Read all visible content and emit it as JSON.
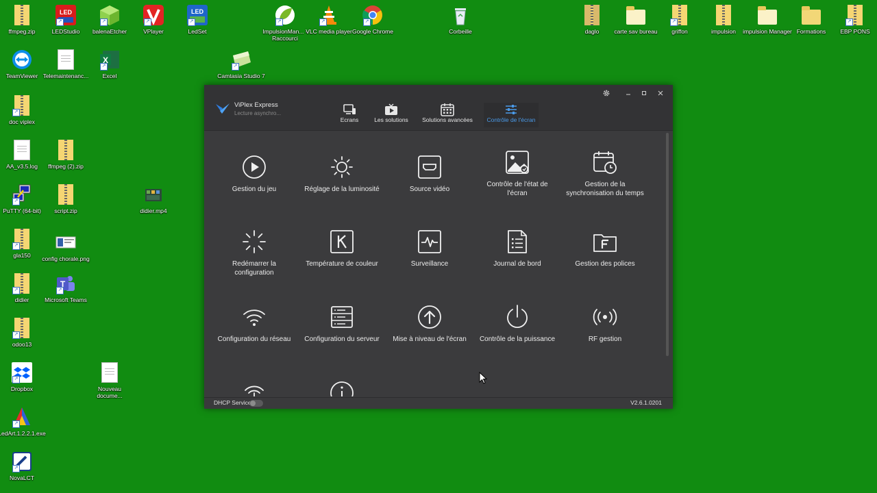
{
  "desktop": {
    "icons": [
      {
        "label": "ffmpeg.zip"
      },
      {
        "label": "LEDStudio"
      },
      {
        "label": "balenaEtcher"
      },
      {
        "label": "VPlayer"
      },
      {
        "label": "LedSet"
      },
      {
        "label": "ImpulsionMan... - Raccourci"
      },
      {
        "label": "VLC media player"
      },
      {
        "label": "Google Chrome"
      },
      {
        "label": "Corbeille"
      },
      {
        "label": "daglo"
      },
      {
        "label": "carte sav bureau"
      },
      {
        "label": "griffon"
      },
      {
        "label": "impulsion"
      },
      {
        "label": "impulsion Manager"
      },
      {
        "label": "Formations"
      },
      {
        "label": "EBP PONS"
      },
      {
        "label": "TeamViewer"
      },
      {
        "label": "Telemaintenanc..."
      },
      {
        "label": "Excel"
      },
      {
        "label": "Camtasia Studio 7"
      },
      {
        "label": "doc viplex"
      },
      {
        "label": "AA_v3.5.log"
      },
      {
        "label": "ffmpeg (2).zip"
      },
      {
        "label": "PuTTY (64-bit)"
      },
      {
        "label": "script.zip"
      },
      {
        "label": "didier.mp4"
      },
      {
        "label": "gla150"
      },
      {
        "label": "config chorale.png"
      },
      {
        "label": "didier"
      },
      {
        "label": "Microsoft Teams"
      },
      {
        "label": "odoo13"
      },
      {
        "label": "Dropbox"
      },
      {
        "label": "Nouveau docume..."
      },
      {
        "label": "LedArt.1.2.2.1.exe"
      },
      {
        "label": "NovaLCT"
      }
    ]
  },
  "app": {
    "name": "ViPlex Express",
    "subtitle": "Lecture asynchro...",
    "nav": [
      {
        "label": "Ecrans"
      },
      {
        "label": "Les solutions"
      },
      {
        "label": "Solutions avancées"
      },
      {
        "label": "Contrôle de l'écran"
      }
    ],
    "active_nav_color": "#4a9ae8",
    "tiles": [
      {
        "label": "Gestion du jeu",
        "icon": "play-circle-icon"
      },
      {
        "label": "Réglage de la luminosité",
        "icon": "brightness-icon"
      },
      {
        "label": "Source vidéo",
        "icon": "video-source-icon"
      },
      {
        "label": "Contrôle de l'état de l'écran",
        "icon": "screen-status-icon"
      },
      {
        "label": "Gestion de la synchronisation du temps",
        "icon": "calendar-clock-icon"
      },
      {
        "label": "Redémarrer la configuration",
        "icon": "loading-spinner-icon"
      },
      {
        "label": "Température de couleur",
        "icon": "k-box-icon"
      },
      {
        "label": "Surveillance",
        "icon": "pulse-monitor-icon"
      },
      {
        "label": "Journal de bord",
        "icon": "log-document-icon"
      },
      {
        "label": "Gestion des polices",
        "icon": "font-folder-icon"
      },
      {
        "label": "Configuration du réseau",
        "icon": "wifi-icon"
      },
      {
        "label": "Configuration du serveur",
        "icon": "server-icon"
      },
      {
        "label": "Mise à niveau de l'écran",
        "icon": "upload-circle-icon"
      },
      {
        "label": "Contrôle de la puissance",
        "icon": "power-icon"
      },
      {
        "label": "RF gestion",
        "icon": "radio-broadcast-icon"
      },
      {
        "label": "",
        "icon": "antenna-icon"
      },
      {
        "label": "",
        "icon": "info-circle-icon"
      }
    ],
    "status": {
      "dhcp_label": "DHCP Service",
      "version": "V2.6.1.0201"
    }
  }
}
